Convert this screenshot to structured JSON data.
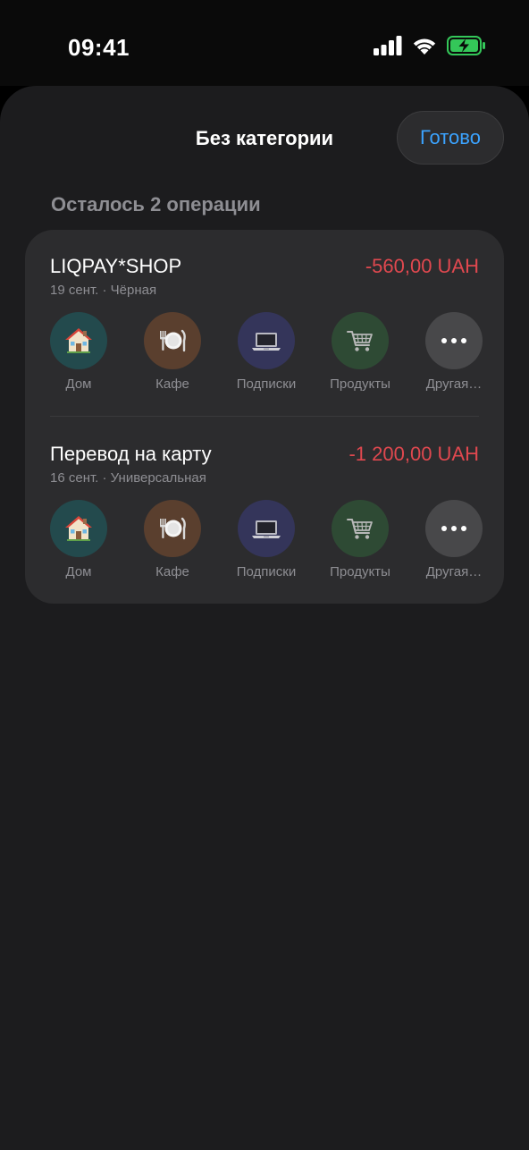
{
  "status_bar": {
    "time": "09:41"
  },
  "sheet": {
    "title": "Без категории",
    "done_label": "Готово",
    "remaining_text": "Осталось 2 операции"
  },
  "transactions": [
    {
      "title": "LIQPAY*SHOP",
      "amount": "-560,00 UAH",
      "meta": "19 сент. · Чёрная"
    },
    {
      "title": "Перевод на карту",
      "amount": "-1 200,00 UAH",
      "meta": "16 сент. · Универсальная"
    }
  ],
  "categories": [
    {
      "label": "Дом",
      "icon": "house-icon",
      "color": "#234a4d"
    },
    {
      "label": "Кафе",
      "icon": "plate-cutlery-icon",
      "color": "#5a3f2e"
    },
    {
      "label": "Подписки",
      "icon": "laptop-icon",
      "color": "#34355a"
    },
    {
      "label": "Продукты",
      "icon": "shopping-cart-icon",
      "color": "#2e4a34"
    },
    {
      "label": "Другая…",
      "icon": "more-dots-icon",
      "color": "#48484a"
    }
  ],
  "colors": {
    "accent": "#3ba3ff",
    "negative_amount": "#e0484f",
    "battery": "#34c759"
  }
}
